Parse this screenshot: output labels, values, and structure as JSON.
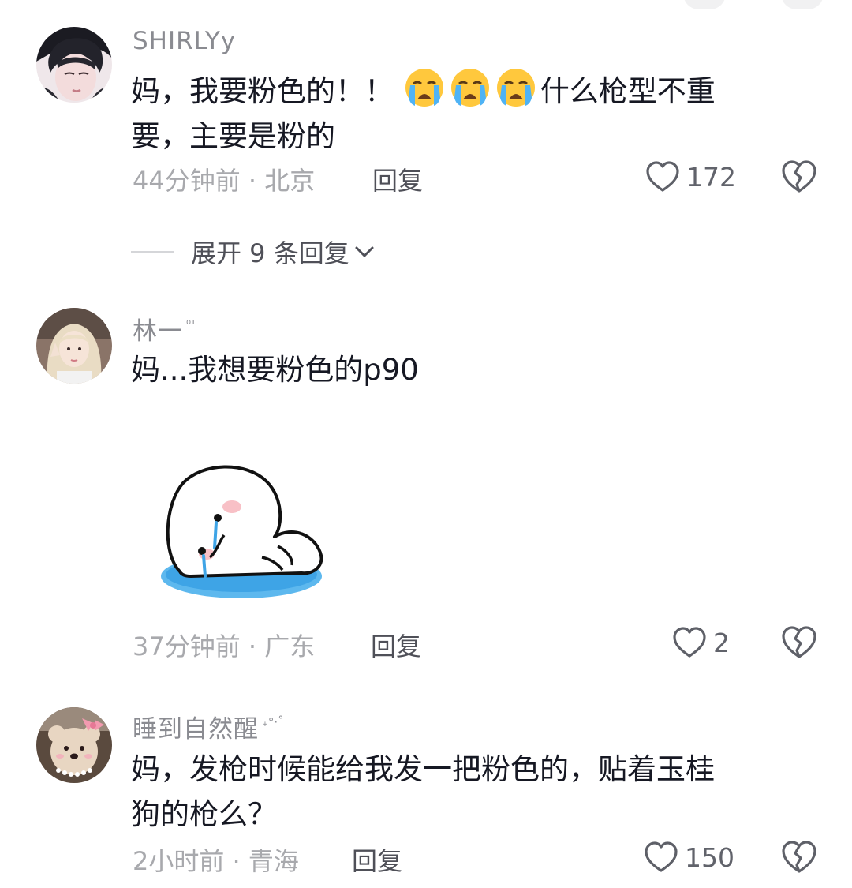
{
  "comments": [
    {
      "username": "SHIRLYy",
      "text_line1": "妈，我要粉色的！！",
      "emoji": [
        "loudly-crying-face",
        "loudly-crying-face",
        "loudly-crying-face"
      ],
      "text_line1_after": "什么枪型不重",
      "text_line2": "要，主要是粉的",
      "meta": "44分钟前 · 北京",
      "reply_label": "回复",
      "like_count": "172",
      "expand_label": "展开 9 条回复"
    },
    {
      "username": "林一",
      "username_suffix": "⁰¹",
      "text_line1": "妈...我想要粉色的p90",
      "sticker": "crying-blob-sticker",
      "meta": "37分钟前 · 广东",
      "reply_label": "回复",
      "like_count": "2"
    },
    {
      "username": "睡到自然醒",
      "username_suffix": "₊°·˚",
      "text_line1": "妈，发枪时候能给我发一把粉色的，贴着玉桂",
      "text_line2": "狗的枪么？",
      "meta": "2小时前 · 青海",
      "reply_label": "回复",
      "like_count": "150"
    }
  ],
  "colors": {
    "username": "#8a8b91",
    "text": "#161823",
    "meta": "#a8a9ad",
    "reply": "#4f5058",
    "icon": "#5e6068"
  }
}
